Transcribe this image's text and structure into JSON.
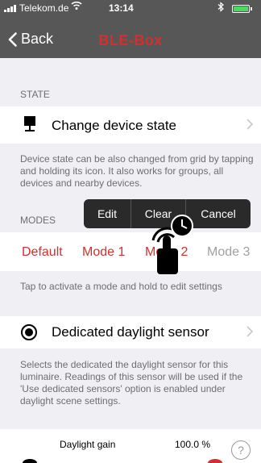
{
  "status_bar": {
    "carrier": "Telekom.de",
    "time": "13:14",
    "wifi_icon": "wifi-icon",
    "bluetooth_icon": "bluetooth-icon",
    "battery_level": 1.0
  },
  "nav": {
    "back_label": "Back",
    "title": "BLE-Box"
  },
  "state_section": {
    "header": "STATE",
    "row_label": "Change device state",
    "icon": "lamp-icon",
    "note": "Device state can be also changed from grid by tapping and holding its icon. It also works for groups, all devices and nearby devices."
  },
  "modes_section": {
    "header": "MODES",
    "modes": [
      "Default",
      "Mode 1",
      "Mode 2",
      "Mode 3"
    ],
    "note": "Tap to activate a mode and hold to edit settings"
  },
  "context_menu": {
    "items": [
      "Edit",
      "Clear",
      "Cancel"
    ]
  },
  "daylight_section": {
    "row_label": "Dedicated daylight sensor",
    "note": "Selects the dedicated the daylight sensor for this luminaire. Readings of this sensor will be used if the 'Use dedicated sensors' option is enabled under daylight scene settings."
  },
  "gain": {
    "label": "Daylight gain",
    "value": "100.0 %"
  },
  "help": {
    "label": "?"
  },
  "colors": {
    "nav_bar": "#575757",
    "accent_red": "#d32f2f",
    "battery_green": "#4cd964",
    "background": "#efeff4"
  }
}
